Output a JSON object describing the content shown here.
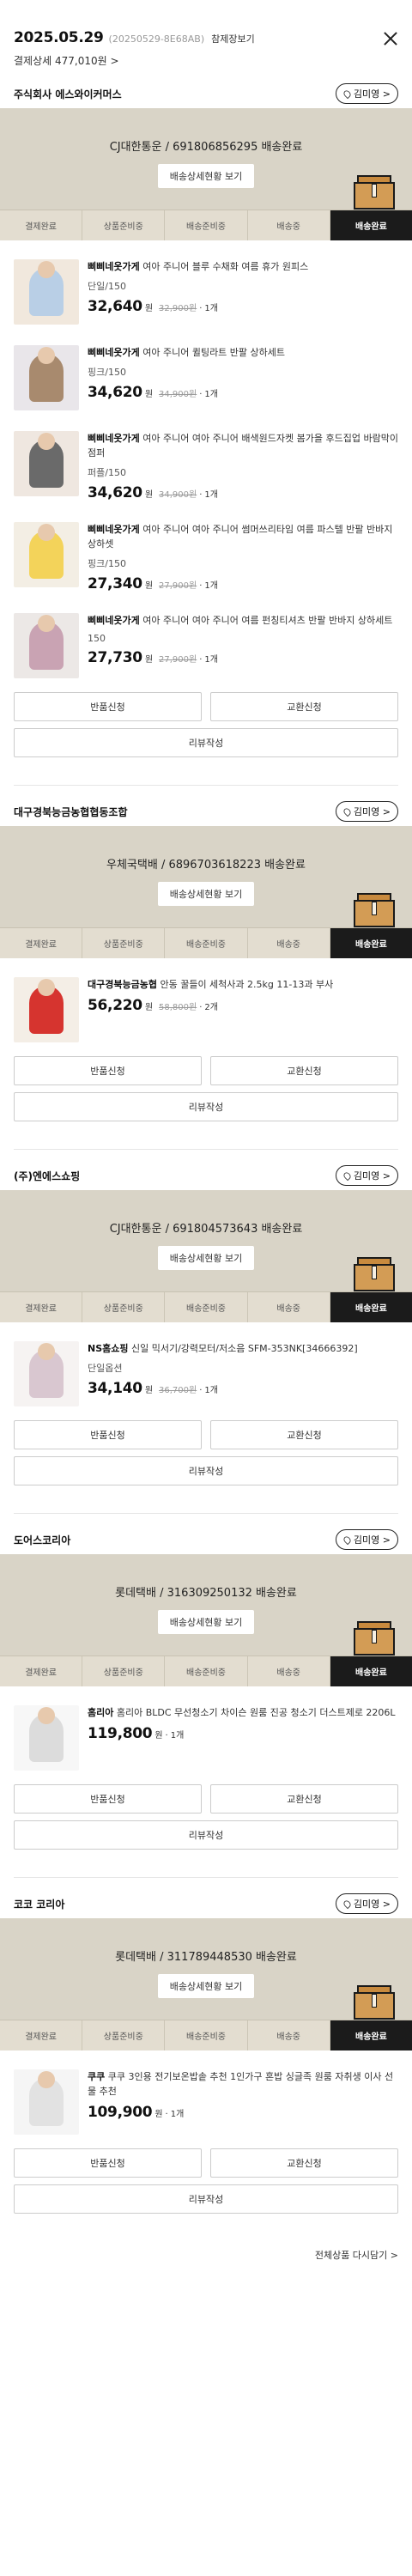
{
  "header": {
    "date": "2025.05.29",
    "order_no": "(20250529-8E68AB)",
    "save_label": "참제장보기",
    "pay_detail": "결제상세 477,010원 >"
  },
  "step_labels": [
    "결제완료",
    "상품준비중",
    "배송준비중",
    "배송중",
    "배송완료"
  ],
  "track_button_label": "배송상세현황 보기",
  "return_label": "반품신청",
  "exchange_label": "교환신청",
  "review_label": "리뷰작성",
  "shipments": [
    {
      "seller": "주식회사 에스와이커머스",
      "location_chip": "김미영 >",
      "tracking": "CJ대한통운 / 691806856295 배송완료",
      "items": [
        {
          "brand": "삐삐네옷가게",
          "name": "여아 주니어 블루 수채화 여름 휴가 원피스",
          "option": "단일/150",
          "price": "32,640",
          "won": "원",
          "original": "32,900원",
          "qty": "1개",
          "colors": [
            "#f1e8dd",
            "#b9cfe6"
          ]
        },
        {
          "brand": "삐삐네옷가게",
          "name": "여아 주니어 퀼팅라트 반팔 상하세트",
          "option": "핑크/150",
          "price": "34,620",
          "won": "원",
          "original": "34,900원",
          "qty": "1개",
          "colors": [
            "#e9e6ea",
            "#a88a6e"
          ]
        },
        {
          "brand": "삐삐네옷가게",
          "name": "여아 주니어 여아 주니어 배색원드자켓 봄가을 후드집업 바람막이 점퍼",
          "option": "퍼플/150",
          "price": "34,620",
          "won": "원",
          "original": "34,900원",
          "qty": "1개",
          "colors": [
            "#efe7e0",
            "#6a6a6a"
          ]
        },
        {
          "brand": "삐삐네옷가게",
          "name": "여아 주니어 여아 주니어 썸머쓰리타임 여름 파스텔 반팔 반바지 상하셋",
          "option": "핑크/150",
          "price": "27,340",
          "won": "원",
          "original": "27,900원",
          "qty": "1개",
          "colors": [
            "#f3eee4",
            "#f3d35a"
          ]
        },
        {
          "brand": "삐삐네옷가게",
          "name": "여아 주니어 여아 주니어 여름 펀칭티셔츠 반팔 반바지 상하세트",
          "option": "150",
          "price": "27,730",
          "won": "원",
          "original": "27,900원",
          "qty": "1개",
          "colors": [
            "#ece8e6",
            "#c9a3b3"
          ]
        }
      ]
    },
    {
      "seller": "대구경북능금농협협동조합",
      "location_chip": "김미영 >",
      "tracking": "우체국택배 / 6896703618223 배송완료",
      "items": [
        {
          "brand": "대구경북능금농협",
          "name": "안동 꿀들이 세척사과 2.5kg 11-13과 부사",
          "option": "",
          "price": "56,220",
          "won": "원",
          "original": "58,800원",
          "qty": "2개",
          "colors": [
            "#f4eee6",
            "#d6342f"
          ]
        }
      ]
    },
    {
      "seller": "(주)엔에스쇼핑",
      "location_chip": "김미영 >",
      "tracking": "CJ대한통운 / 691804573643 배송완료",
      "items": [
        {
          "brand": "NS홈쇼핑",
          "name": "신일 믹서기/강력모터/저소음 SFM-353NK[34666392]",
          "option": "단일옵션",
          "price": "34,140",
          "won": "원",
          "original": "36,700원",
          "qty": "1개",
          "colors": [
            "#f6f3f2",
            "#d9c7d0"
          ]
        }
      ]
    },
    {
      "seller": "도어스코리아",
      "location_chip": "김미영 >",
      "tracking": "롯데택배 / 316309250132 배송완료",
      "items": [
        {
          "brand": "홈리아",
          "name": "홈리아 BLDC 무선청소기 차이슨 원룸 진공 청소기 더스트제로 2206L",
          "option": "",
          "price": "119,800",
          "won": "원",
          "original": "",
          "qty": "1개",
          "colors": [
            "#f7f7f7",
            "#dcdcdc"
          ]
        }
      ]
    },
    {
      "seller": "코코 코리아",
      "location_chip": "김미영 >",
      "tracking": "롯데택배 / 311789448530 배송완료",
      "items": [
        {
          "brand": "쿠쿠",
          "name": "쿠쿠 3인용 전기보온밥솥 추천 1인가구 혼밥 싱글족 원룸 자취생 이사 선물 추천",
          "option": "",
          "price": "109,900",
          "won": "원",
          "original": "",
          "qty": "1개",
          "colors": [
            "#f5f5f5",
            "#e2e2e2"
          ]
        }
      ]
    }
  ],
  "footer_link": "전체상품 다시담기 >"
}
